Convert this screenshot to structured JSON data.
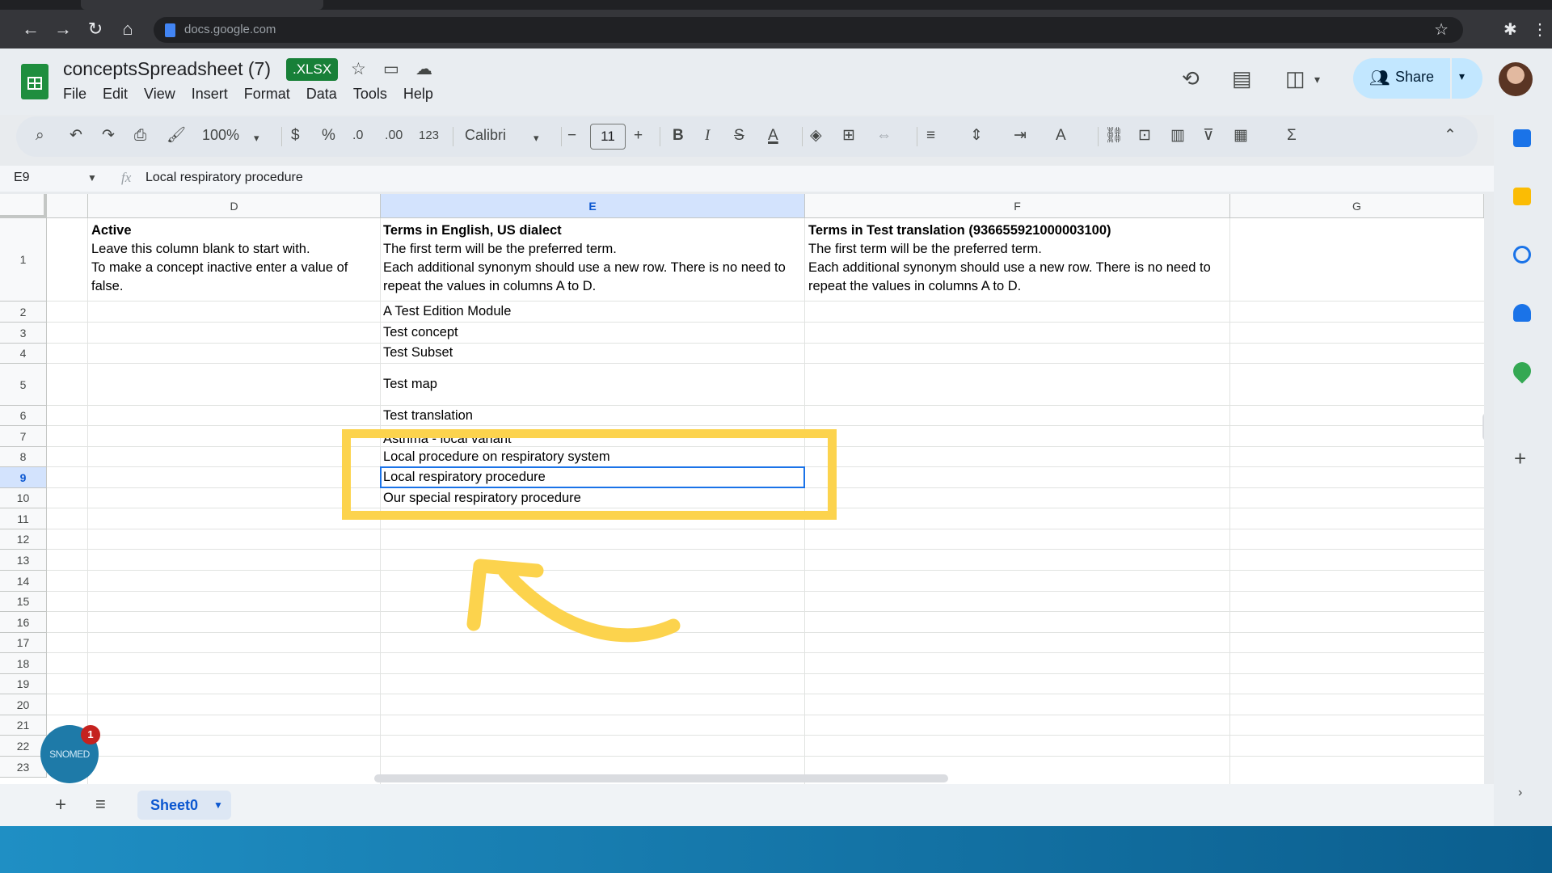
{
  "browser": {
    "url": "docs.google.com"
  },
  "app": {
    "title": "conceptsSpreadsheet (7)",
    "format_badge": ".XLSX",
    "menu": [
      "File",
      "Edit",
      "View",
      "Insert",
      "Format",
      "Data",
      "Tools",
      "Help"
    ],
    "share_label": "Share",
    "colors": {
      "accent": "#1a73e8",
      "share_bg": "#c2e7ff",
      "highlight": "#fcd34d",
      "sheets_green": "#1e8e3e"
    }
  },
  "toolbar": {
    "zoom": "100%",
    "currency": "$",
    "percent": "%",
    "decrease_decimal": ".0",
    "increase_decimal": ".00",
    "number_format": "123",
    "font": "Calibri",
    "font_size": "11"
  },
  "formula_bar": {
    "cell_ref": "E9",
    "fx": "fx",
    "content": "Local respiratory procedure"
  },
  "columns": [
    "D",
    "E",
    "F",
    "G"
  ],
  "rows": [
    "1",
    "2",
    "3",
    "4",
    "5",
    "6",
    "7",
    "8",
    "9",
    "10",
    "11",
    "12",
    "13",
    "14",
    "15",
    "16",
    "17",
    "18",
    "19",
    "20",
    "21",
    "22",
    "23"
  ],
  "cells": {
    "D1": {
      "heading": "Active",
      "lines": [
        "Leave this column blank to start with.",
        "To make a concept inactive enter a value of",
        "false."
      ]
    },
    "E1": {
      "heading": "Terms in English, US dialect",
      "lines": [
        "The first term will be the preferred term.",
        "Each additional synonym should use a new row. There is no need to",
        "repeat the values in columns A to D."
      ]
    },
    "F1": {
      "heading": "Terms in Test translation (936655921000003100)",
      "lines": [
        "The first term will be the preferred term.",
        "Each additional synonym should use a new row. There is no need to",
        "repeat the values in columns A to D."
      ]
    },
    "E2": "A Test Edition Module",
    "E3": "Test concept",
    "E4": "Test Subset",
    "E5": "Test map",
    "E6": "Test translation",
    "E7": "Asthma - local variant",
    "E8": "Local procedure on respiratory system",
    "E9": "Local respiratory procedure",
    "E10": "Our special respiratory procedure"
  },
  "sheet_tabs": [
    "Sheet0"
  ],
  "overlay": {
    "badge_text": "SNOMED",
    "notification_count": "1"
  },
  "icons": [
    "back-icon",
    "forward-icon",
    "reload-icon",
    "home-icon",
    "star-icon",
    "extensions-icon",
    "menu-dots-icon",
    "history-icon",
    "comment-icon",
    "meet-icon",
    "people-icon",
    "search-icon",
    "undo-icon",
    "redo-icon",
    "print-icon",
    "paint-format-icon",
    "bold-icon",
    "italic-icon",
    "strikethrough-icon",
    "text-color-icon",
    "fill-color-icon",
    "borders-icon",
    "merge-icon",
    "align-icon",
    "valign-icon",
    "wrap-icon",
    "rotate-icon",
    "link-icon",
    "insert-comment-icon",
    "chart-icon",
    "filter-icon",
    "table-icon",
    "functions-icon",
    "collapse-icon",
    "calendar-icon",
    "keep-icon",
    "tasks-icon",
    "contacts-icon",
    "maps-icon",
    "add-icon"
  ]
}
